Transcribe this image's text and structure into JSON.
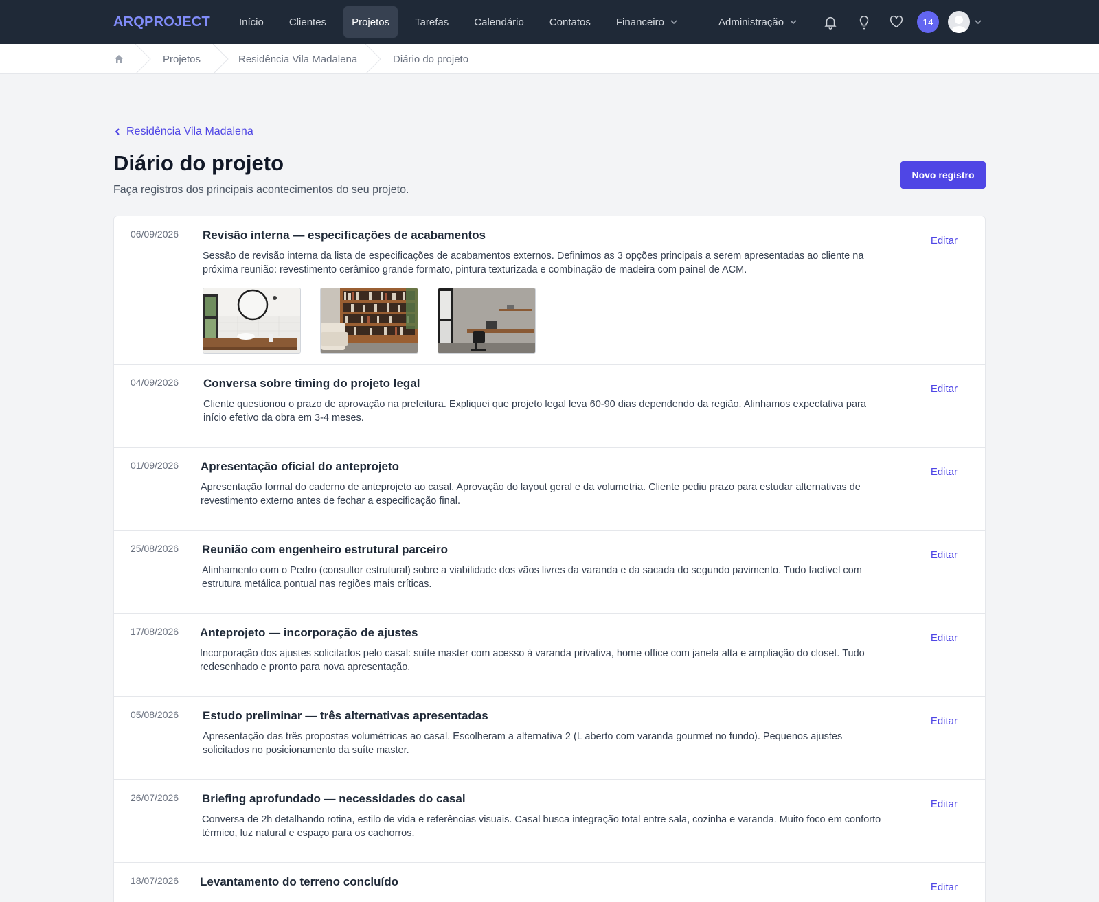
{
  "app": {
    "logo": "ARQPROJECT"
  },
  "nav": {
    "items": [
      {
        "label": "Início"
      },
      {
        "label": "Clientes"
      },
      {
        "label": "Projetos"
      },
      {
        "label": "Tarefas"
      },
      {
        "label": "Calendário"
      },
      {
        "label": "Contatos"
      },
      {
        "label": "Financeiro"
      }
    ],
    "active": "Projetos",
    "admin_label": "Administração",
    "notification_count": "14"
  },
  "breadcrumb": {
    "items": [
      "Projetos",
      "Residência Vila Madalena",
      "Diário do projeto"
    ]
  },
  "header": {
    "back_label": "Residência Vila Madalena",
    "title": "Diário do projeto",
    "subtitle": "Faça registros dos principais acontecimentos do seu projeto.",
    "new_button": "Novo registro"
  },
  "entries": [
    {
      "date": "06/09/2026",
      "title": "Revisão interna — especificações de acabamentos",
      "description": "Sessão de revisão interna da lista de especificações de acabamentos externos. Definimos as 3 opções principais a serem apresentadas ao cliente na próxima reunião: revestimento cerâmico grande formato, pintura texturizada e combinação de madeira com painel de ACM.",
      "edit": "Editar",
      "images": [
        "bathroom-vanity",
        "bookshelf-library",
        "home-office-desk"
      ]
    },
    {
      "date": "04/09/2026",
      "title": "Conversa sobre timing do projeto legal",
      "description": "Cliente questionou o prazo de aprovação na prefeitura. Expliquei que projeto legal leva 60-90 dias dependendo da região. Alinhamos expectativa para início efetivo da obra em 3-4 meses.",
      "edit": "Editar"
    },
    {
      "date": "01/09/2026",
      "title": "Apresentação oficial do anteprojeto",
      "description": "Apresentação formal do caderno de anteprojeto ao casal. Aprovação do layout geral e da volumetria. Cliente pediu prazo para estudar alternativas de revestimento externo antes de fechar a especificação final.",
      "edit": "Editar"
    },
    {
      "date": "25/08/2026",
      "title": "Reunião com engenheiro estrutural parceiro",
      "description": "Alinhamento com o Pedro (consultor estrutural) sobre a viabilidade dos vãos livres da varanda e da sacada do segundo pavimento. Tudo factível com estrutura metálica pontual nas regiões mais críticas.",
      "edit": "Editar"
    },
    {
      "date": "17/08/2026",
      "title": "Anteprojeto — incorporação de ajustes",
      "description": "Incorporação dos ajustes solicitados pelo casal: suíte master com acesso à varanda privativa, home office com janela alta e ampliação do closet. Tudo redesenhado e pronto para nova apresentação.",
      "edit": "Editar"
    },
    {
      "date": "05/08/2026",
      "title": "Estudo preliminar — três alternativas apresentadas",
      "description": "Apresentação das três propostas volumétricas ao casal. Escolheram a alternativa 2 (L aberto com varanda gourmet no fundo). Pequenos ajustes solicitados no posicionamento da suíte master.",
      "edit": "Editar"
    },
    {
      "date": "26/07/2026",
      "title": "Briefing aprofundado — necessidades do casal",
      "description": "Conversa de 2h detalhando rotina, estilo de vida e referências visuais. Casal busca integração total entre sala, cozinha e varanda. Muito foco em conforto térmico, luz natural e espaço para os cachorros.",
      "edit": "Editar"
    },
    {
      "date": "18/07/2026",
      "title": "Levantamento do terreno concluído",
      "description": "",
      "edit": "Editar"
    }
  ]
}
